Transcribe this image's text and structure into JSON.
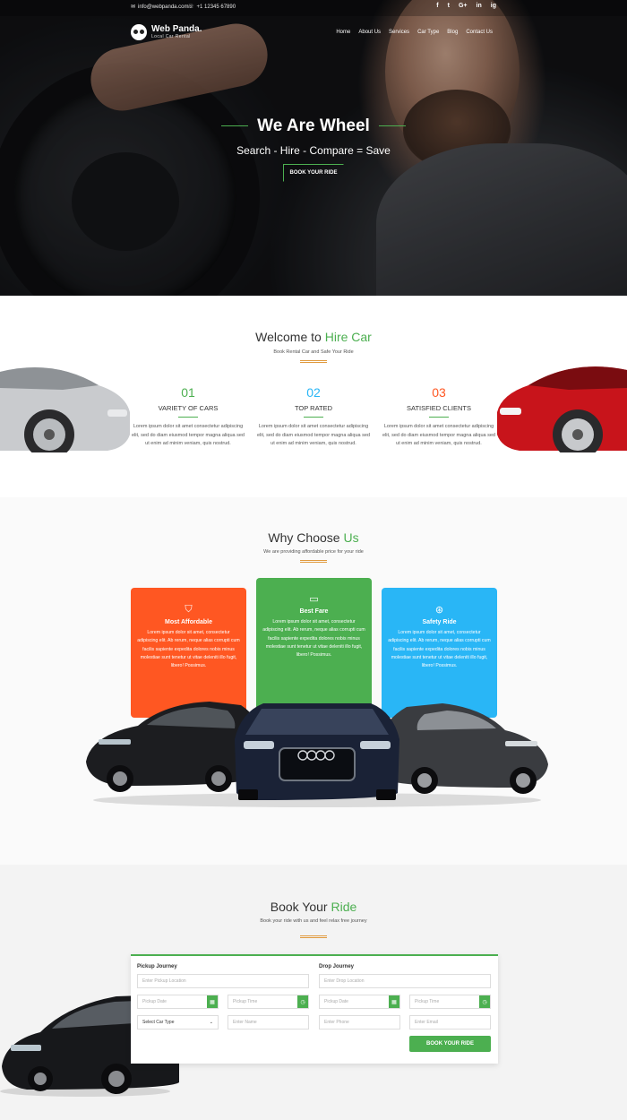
{
  "topbar": {
    "email": "info@webpanda.com",
    "phone": "+1 12345 67890",
    "socials": [
      "f",
      "t",
      "G+",
      "in",
      "ig"
    ]
  },
  "brand": {
    "name": "Web Panda.",
    "tagline": "Local Car Rental"
  },
  "nav": [
    "Home",
    "About Us",
    "Services",
    "Car Type",
    "Blog",
    "Contact Us"
  ],
  "hero": {
    "title": "We Are Wheel",
    "subtitle": "Search - Hire - Compare = Save",
    "cta": "BOOK YOUR RIDE"
  },
  "welcome": {
    "title_prefix": "Welcome to",
    "title_accent": "Hire Car",
    "subtitle": "Book Rental Car and Safe Your Ride",
    "stats": [
      {
        "number": "01",
        "label": "VARIETY OF CARS",
        "text": "Lorem ipsum dolor sit amet consectetur adipiscing elit, sed do diam eiusmod tempor magna aliqua sed ut enim ad minim veniam, quis nostrud.",
        "color": "#4caf50"
      },
      {
        "number": "02",
        "label": "TOP RATED",
        "text": "Lorem ipsum dolor sit amet consectetur adipiscing elit, sed do diam eiusmod tempor magna aliqua sed ut enim ad minim veniam, quis nostrud.",
        "color": "#29b6f6"
      },
      {
        "number": "03",
        "label": "SATISFIED CLIENTS",
        "text": "Lorem ipsum dolor sit amet consectetur adipiscing elit, sed do diam eiusmod tempor magna aliqua sed ut enim ad minim veniam, quis nostrud.",
        "color": "#ff5722"
      }
    ]
  },
  "why": {
    "title_prefix": "Why Choose",
    "title_accent": "Us",
    "subtitle": "We are providing affordable price for your ride",
    "cards": [
      {
        "title": "Most Affordable",
        "icon": "tag-icon",
        "color": "#ff5722",
        "text": "Lorem ipsum dolor sit amet, consectetur adipiscing elit. Ab rerum, neque alias corrupti cum facilis sapiente expedita dolores nobis minus molestiae sunt tenetur ut vitae deleniti illo fugit, libero! Possimus."
      },
      {
        "title": "Best Fare",
        "icon": "wallet-icon",
        "color": "#4caf50",
        "text": "Lorem ipsum dolor sit amet, consectetur adipiscing elit. Ab rerum, neque alias corrupti cum facilis sapiente expedita dolores nobis minus molestiae sunt tenetur ut vitae deleniti illo fugit, libero! Possimus."
      },
      {
        "title": "Safety Ride",
        "icon": "steering-wheel-icon",
        "color": "#29b6f6",
        "text": "Lorem ipsum dolor sit amet, consectetur adipiscing elit. Ab rerum, neque alias corrupti cum facilis sapiente expedita dolores nobis minus molestiae sunt tenetur ut vitae deleniti illo fugit, libero! Possimus."
      }
    ]
  },
  "booking": {
    "title_prefix": "Book Your",
    "title_accent": "Ride",
    "subtitle": "Book your ride with us and feel relax free journey",
    "pickup": {
      "heading": "Pickup Journey",
      "location_placeholder": "Enter Pickup Location",
      "date_placeholder": "Pickup Date",
      "time_placeholder": "Pickup Time",
      "car_type": "Select Car Type",
      "name_placeholder": "Enter Name"
    },
    "drop": {
      "heading": "Drop Journey",
      "location_placeholder": "Enter Drop Location",
      "date_placeholder": "Pickup Date",
      "time_placeholder": "Pickup Time",
      "phone_placeholder": "Enter Phone",
      "email_placeholder": "Enter Email"
    },
    "submit": "BOOK YOUR RIDE"
  },
  "colors": {
    "accent": "#4caf50",
    "orange": "#ff5722",
    "blue": "#29b6f6",
    "gold": "#e09a3e"
  }
}
